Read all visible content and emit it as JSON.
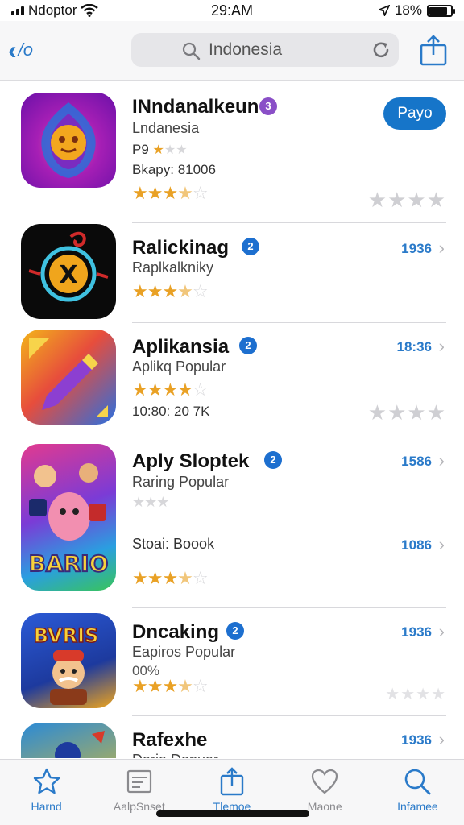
{
  "status_bar": {
    "carrier": "Ndoptor",
    "time": "29:AM",
    "battery_text": "18%",
    "battery_level": 0.85
  },
  "nav": {
    "back_label": "/o",
    "search_value": "Indonesia",
    "accent_color": "#2a7ac9"
  },
  "apps": [
    {
      "name": "INndanalkeun",
      "badge": "3",
      "badge_color": "#8a4fc7",
      "subtitle": "Lndanesia",
      "meta1": "P9",
      "meta2": "Bkapy: 81006",
      "action_label": "Payo",
      "rating": 3.5
    },
    {
      "name": "Ralickinag",
      "badge": "2",
      "badge_color": "#1d6fcf",
      "subtitle": "Raplkalkniky",
      "price": "1936",
      "rating": 3.5
    },
    {
      "name": "Aplikansia",
      "badge": "2",
      "badge_color": "#1d6fcf",
      "subtitle": "Aplikq Popular",
      "meta": "10:80: 20 7K",
      "price": "18:36",
      "rating": 4
    },
    {
      "name": "Aply Sloptek",
      "badge": "2",
      "badge_color": "#1d6fcf",
      "subtitle": "Raring Popular",
      "meta": "Stoai: Boook",
      "price_top": "1586",
      "price": "1086",
      "rating": 3.5
    },
    {
      "name": "Dncaking",
      "badge": "2",
      "badge_color": "#1d6fcf",
      "subtitle": "Eapiros Popular",
      "meta": "00%",
      "price": "1936",
      "rating": 3.5
    },
    {
      "name": "Rafexhe",
      "subtitle": "Daria Danuar",
      "price": "1936"
    }
  ],
  "tabs": [
    {
      "label": "Harnd",
      "icon": "star-icon"
    },
    {
      "label": "AalpSnset",
      "icon": "list-icon"
    },
    {
      "label": "Tlemoe",
      "icon": "share-icon"
    },
    {
      "label": "Maone",
      "icon": "heart-icon"
    },
    {
      "label": "Infamee",
      "icon": "search-icon"
    }
  ]
}
